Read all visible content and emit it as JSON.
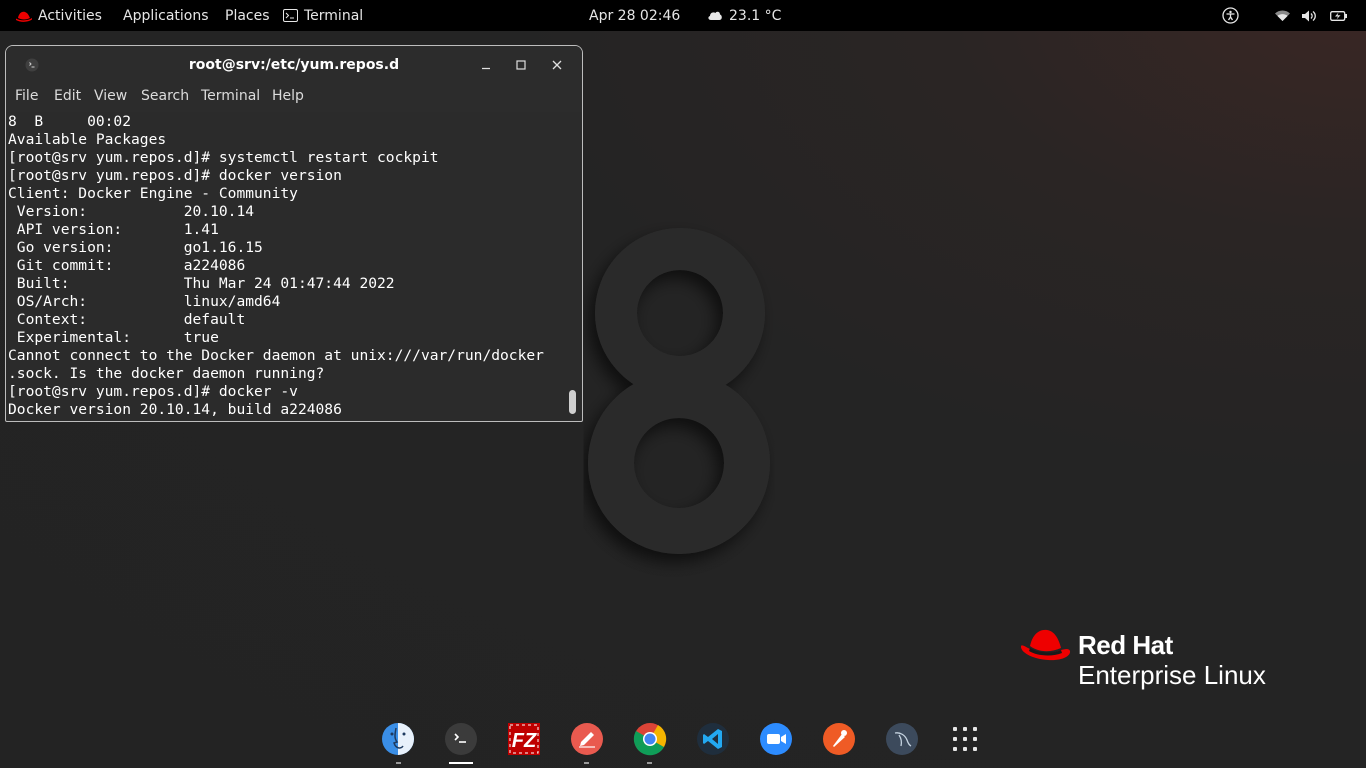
{
  "topbar": {
    "activities": "Activities",
    "applications": "Applications",
    "places": "Places",
    "terminal_app": "Terminal",
    "clock": "Apr 28  02:46",
    "weather": "23.1 °C"
  },
  "wallpaper": {
    "brand_line1": "Red Hat",
    "brand_line2": "Enterprise Linux"
  },
  "terminal": {
    "title": "root@srv:/etc/yum.repos.d",
    "menu": [
      "File",
      "Edit",
      "View",
      "Search",
      "Terminal",
      "Help"
    ],
    "lines": [
      "8  B     00:02",
      "Available Packages",
      "[root@srv yum.repos.d]# systemctl restart cockpit",
      "[root@srv yum.repos.d]# docker version",
      "Client: Docker Engine - Community",
      " Version:           20.10.14",
      " API version:       1.41",
      " Go version:        go1.16.15",
      " Git commit:        a224086",
      " Built:             Thu Mar 24 01:47:44 2022",
      " OS/Arch:           linux/amd64",
      " Context:           default",
      " Experimental:      true",
      "Cannot connect to the Docker daemon at unix:///var/run/docker",
      ".sock. Is the docker daemon running?",
      "[root@srv yum.repos.d]# docker -v",
      "Docker version 20.10.14, build a224086"
    ]
  },
  "dock": {
    "items": [
      "finder-icon",
      "terminal-icon",
      "filezilla-icon",
      "text-editor-icon",
      "chrome-icon",
      "vscode-icon",
      "zoom-icon",
      "postman-icon",
      "mysql-workbench-icon",
      "app-grid-icon"
    ],
    "filezilla_glyph": "FZ"
  },
  "colors": {
    "redhat_red": "#ee0000",
    "topbar_bg": "#000000",
    "terminal_bg": "#2b2b2b"
  }
}
